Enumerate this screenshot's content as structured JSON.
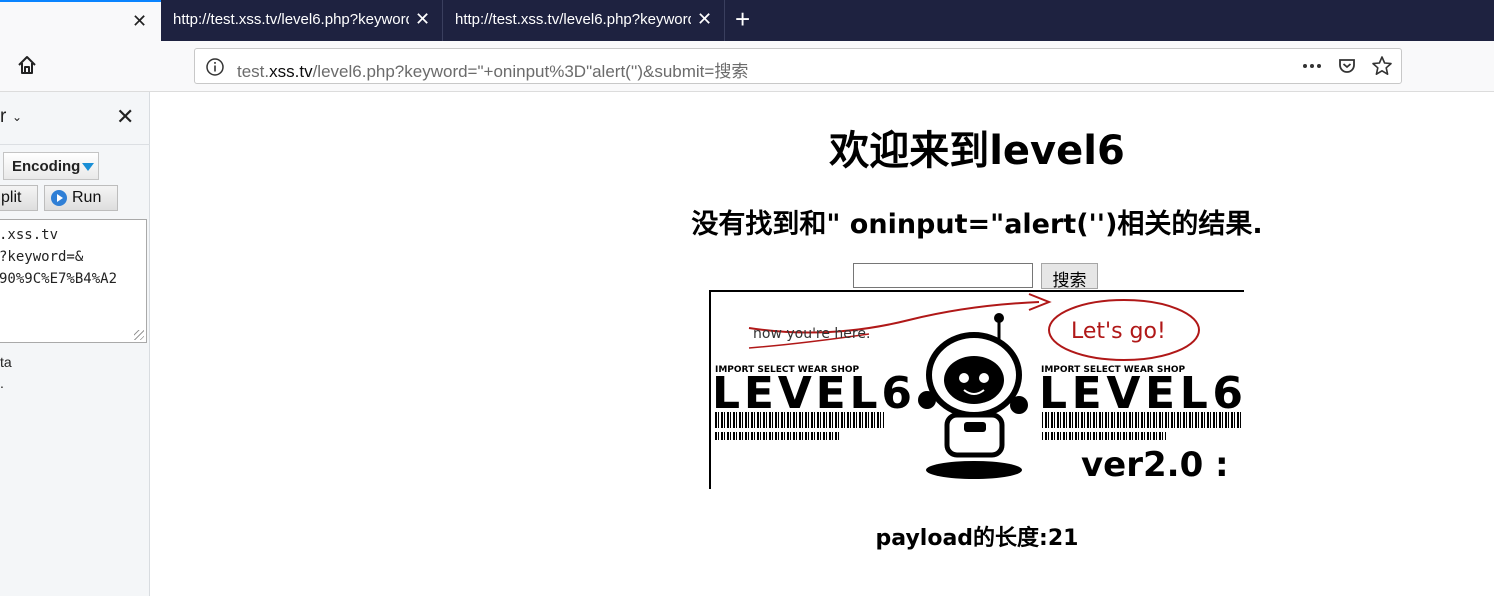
{
  "tabs": [
    {
      "title": "",
      "close": "✕"
    },
    {
      "title": "http://test.xss.tv/level6.php?keyword=",
      "close": "✕"
    },
    {
      "title": "http://test.xss.tv/level6.php?keyword=",
      "close": "✕"
    }
  ],
  "new_tab": "+",
  "address": {
    "prefix": "test.",
    "host": "xss.tv",
    "path": "/level6.php?keyword=\"+oninput%3D\"alert('')&submit=搜索"
  },
  "sidebar": {
    "title": "r",
    "chevron": "⌄",
    "close": "✕",
    "encoding_label": "Encoding",
    "split_label": "plit",
    "run_label": "Run",
    "url_lines": [
      ".xss.tv",
      "?keyword=&",
      "90%9C%E7%B4%A2"
    ],
    "option1": "ta",
    "option2": "."
  },
  "page": {
    "heading": "欢迎来到level6",
    "result_text": "没有找到和\" oninput=\"alert('')相关的结果.",
    "search_button": "搜索",
    "banner": {
      "note": "now you're here.",
      "bubble": "Let's go!",
      "shop_left": "IMPORT SELECT WEAR SHOP",
      "shop_right": "IMPORT SELECT WEAR SHOP",
      "level_left": "LEVEL6",
      "level_right": "LEVEL6",
      "version": "ver2.0 :"
    },
    "payload_text": "payload的长度:21"
  }
}
